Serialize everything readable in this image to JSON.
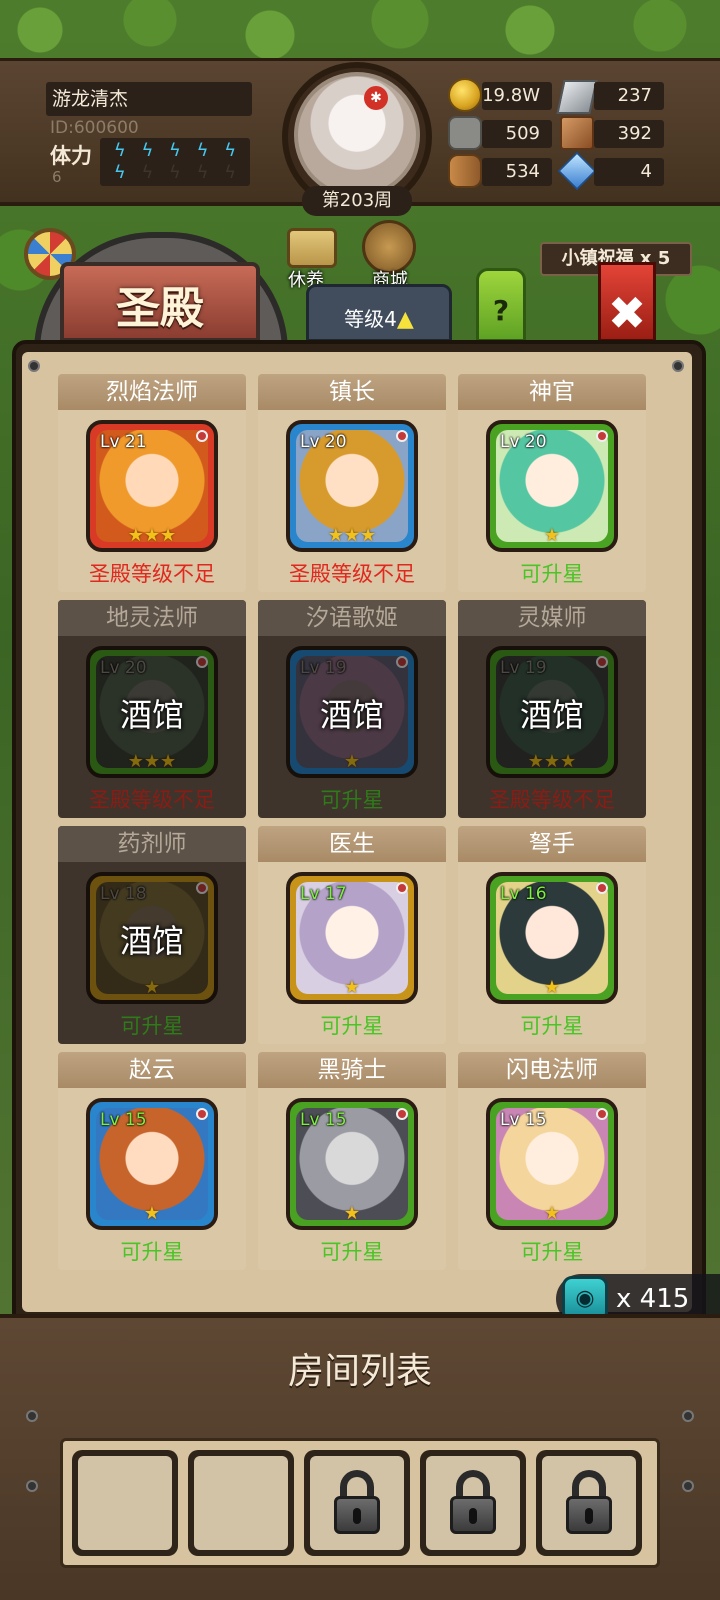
{
  "hud": {
    "player_name": "游龙清杰",
    "player_id": "ID:600600",
    "stamina_label": "体力",
    "stamina_value": "6",
    "stamina_full_bolts": 6,
    "stamina_max_bolts": 10,
    "week_label": "第203周",
    "resources": {
      "gold": "19.8W",
      "iron": "237",
      "stone": "509",
      "hide": "392",
      "wood": "534",
      "crystal": "4"
    }
  },
  "menu": {
    "rest_label": "休养",
    "shop_label": "商城",
    "town_blessing": "小镇祝福 x 5"
  },
  "temple": {
    "title": "圣殿",
    "level_label": "等级4",
    "help_label": "?",
    "close_label": "✖"
  },
  "heroes": [
    {
      "name": "烈焰法师",
      "level": "Lv 21",
      "stars": "★★★",
      "status": "圣殿等级不足",
      "status_type": "red",
      "frame": "red",
      "tone": "fire",
      "locked": false
    },
    {
      "name": "镇长",
      "level": "Lv 20",
      "stars": "★★★",
      "status": "圣殿等级不足",
      "status_type": "red",
      "frame": "blue",
      "tone": "mayor",
      "locked": false
    },
    {
      "name": "神官",
      "level": "Lv 20",
      "stars": "★",
      "status": "可升星",
      "status_type": "green",
      "frame": "green",
      "tone": "priest",
      "locked": false
    },
    {
      "name": "地灵法师",
      "level": "Lv 20",
      "stars": "★★★",
      "status": "圣殿等级不足",
      "status_type": "red",
      "frame": "green",
      "tone": "earth",
      "locked": true,
      "tag": "酒馆"
    },
    {
      "name": "汐语歌姬",
      "level": "Lv 19",
      "stars": "★",
      "status": "可升星",
      "status_type": "green",
      "frame": "blue",
      "tone": "singer",
      "locked": true,
      "tag": "酒馆"
    },
    {
      "name": "灵媒师",
      "level": "Lv 19",
      "stars": "★★★",
      "status": "圣殿等级不足",
      "status_type": "red",
      "frame": "green",
      "tone": "medium",
      "locked": true,
      "tag": "酒馆"
    },
    {
      "name": "药剂师",
      "level": "Lv 18",
      "stars": "★",
      "status": "可升星",
      "status_type": "green",
      "frame": "gold",
      "tone": "potion",
      "locked": true,
      "tag": "酒馆"
    },
    {
      "name": "医生",
      "level": "Lv 17",
      "stars": "★",
      "status": "可升星",
      "status_type": "green",
      "frame": "gold",
      "tone": "doctor",
      "locked": false,
      "lv_green": true
    },
    {
      "name": "弩手",
      "level": "Lv 16",
      "stars": "★",
      "status": "可升星",
      "status_type": "green",
      "frame": "green",
      "tone": "crossbow",
      "locked": false,
      "lv_green": true
    },
    {
      "name": "赵云",
      "level": "Lv 15",
      "stars": "★",
      "status": "可升星",
      "status_type": "green",
      "frame": "blue",
      "tone": "zhaoyun",
      "locked": false,
      "lv_green": true
    },
    {
      "name": "黑骑士",
      "level": "Lv 15",
      "stars": "★",
      "status": "可升星",
      "status_type": "green",
      "frame": "green",
      "tone": "knight",
      "locked": false,
      "lv_green": true
    },
    {
      "name": "闪电法师",
      "level": "Lv 15",
      "stars": "★",
      "status": "可升星",
      "status_type": "green",
      "frame": "green",
      "tone": "lightning",
      "locked": false
    }
  ],
  "soul_stones": "x 415",
  "rooms": {
    "title": "房间列表",
    "slots": [
      {
        "state": "empty"
      },
      {
        "state": "empty"
      },
      {
        "state": "locked"
      },
      {
        "state": "locked"
      },
      {
        "state": "locked"
      }
    ]
  },
  "colors": {
    "status_red": "#e0281e",
    "status_green": "#4bc427",
    "stamina_bolt": "#46c8f0",
    "star": "#f2c21a"
  }
}
